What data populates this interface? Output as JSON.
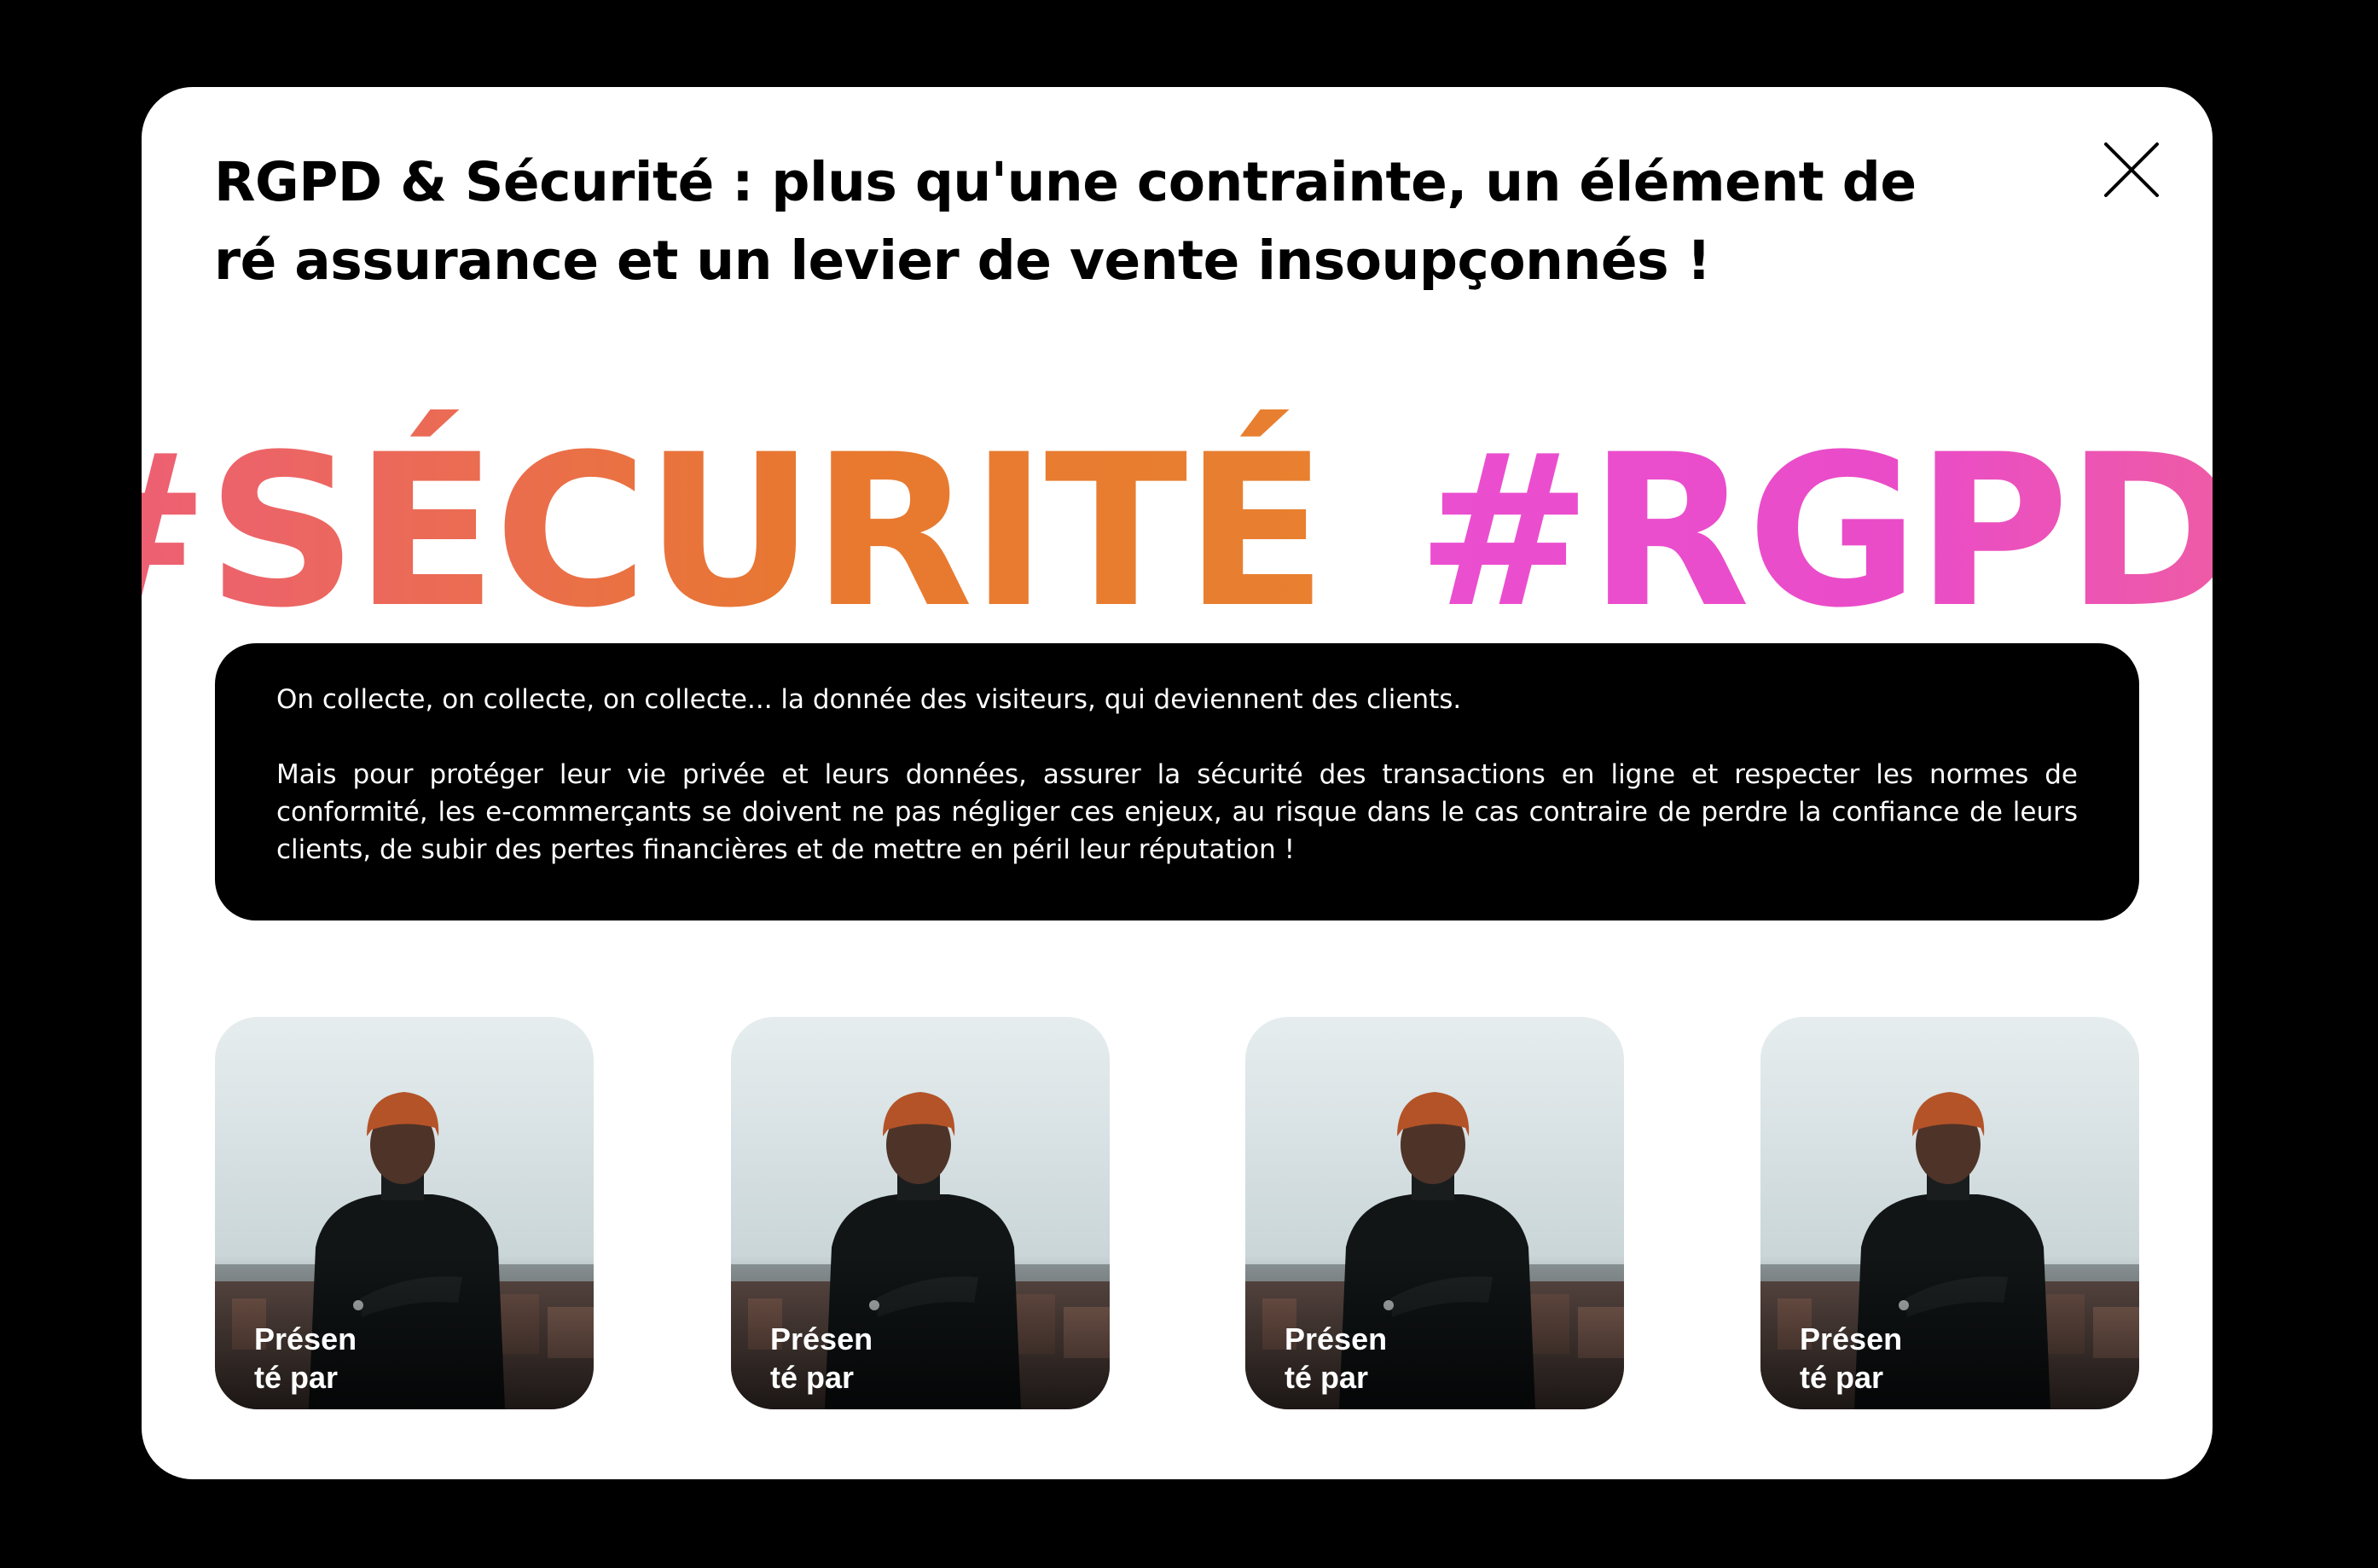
{
  "modal": {
    "title": "RGPD & Sécurité : plus qu'une contrainte, un élément de ré assurance et un levier de vente insoupçonnés !",
    "close_icon": "close-icon"
  },
  "hashtags": [
    "#SÉCURITÉ",
    "#RGPD",
    "#"
  ],
  "intro": {
    "paragraph_1": "On collecte, on collecte, on collecte... la donnée des visiteurs, qui deviennent des clients.",
    "paragraph_2": "Mais pour protéger leur vie privée et leurs données, assurer la sécurité des transactions en ligne et respecter les normes de conformité, les e-commerçants se doivent ne pas négliger ces enjeux, au risque dans le cas contraire de perdre la confiance de leurs clients, de subir des pertes financières et de mettre en péril leur réputation !"
  },
  "cards": [
    {
      "label": "Présenté par",
      "image": "speaker-photo"
    },
    {
      "label": "Présenté par",
      "image": "speaker-photo"
    },
    {
      "label": "Présenté par",
      "image": "speaker-photo"
    },
    {
      "label": "Présenté par",
      "image": "speaker-photo"
    }
  ],
  "colors": {
    "background": "#000000",
    "modal": "#ffffff",
    "hashtag_orange": "#e8782f",
    "hashtag_coral": "#ee5c7e",
    "hashtag_pink": "#ea4cc8"
  }
}
